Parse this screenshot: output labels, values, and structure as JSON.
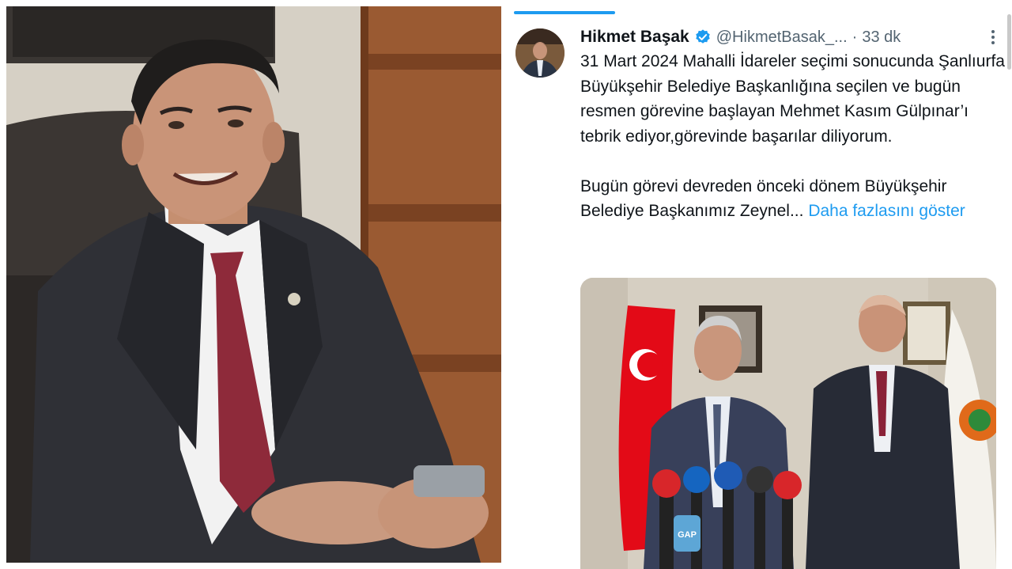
{
  "tweet": {
    "author": {
      "display_name": "Hikmet Başak",
      "handle": "@HikmetBasak_...",
      "verified": true,
      "avatar_icon": "profile-photo"
    },
    "separator": "·",
    "time_ago": "33 dk",
    "more_icon": "ellipsis-vertical-icon",
    "text_paragraph_1": "31 Mart 2024 Mahalli İdareler seçimi sonucunda Şanlıurfa Büyükşehir Belediye Başkanlığına seçilen ve bugün resmen görevine başlayan Mehmet Kasım Gülpınar’ı tebrik ediyor,görevinde başarılar diliyorum.",
    "text_paragraph_2": "Bugün görevi devreden  önceki dönem Büyükşehir Belediye Başkanımız Zeynel...",
    "show_more_label": "Daha fazlasını göster",
    "media": {
      "description_icon": "photo-two-men-at-press-podium",
      "mic_labels": [
        "GAP"
      ]
    }
  },
  "colors": {
    "accent": "#1d9bf0",
    "text_primary": "#0f1419",
    "text_secondary": "#536471",
    "flag_red": "#e30a17"
  }
}
